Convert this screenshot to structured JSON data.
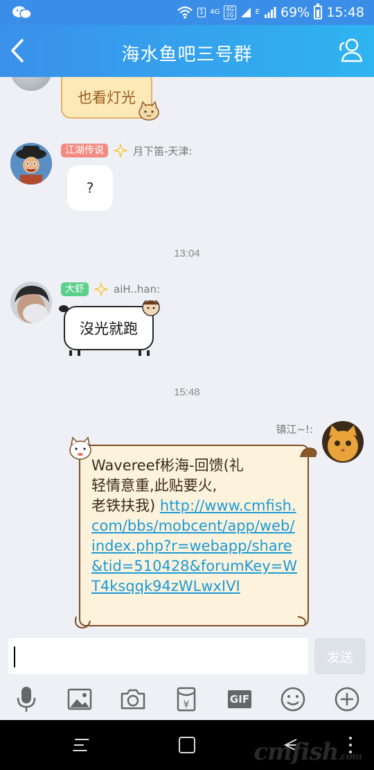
{
  "status_bar": {
    "network": "4G",
    "sim_label": "1",
    "dual_network": "4G\n2G",
    "e_label": "E",
    "battery": "69%",
    "time": "15:48"
  },
  "header": {
    "title": "海水鱼吧三号群"
  },
  "messages": [
    {
      "type": "text",
      "text": "也看灯光"
    },
    {
      "type": "text",
      "badge": "江湖传说",
      "sender": "月下笛-天津:",
      "text": "?"
    },
    {
      "type": "time",
      "text": "13:04"
    },
    {
      "type": "text",
      "badge": "大虾",
      "sender": "aiH..han:",
      "text": "沒光就跑"
    },
    {
      "type": "time",
      "text": "15:48"
    },
    {
      "type": "text",
      "sender": "镇江~!:",
      "text_plain": "Wavereef彬海-回馈(礼轻情意重,此贴要火,老铁扶我)",
      "text_line1": "Wavereef彬海-回馈(礼",
      "text_line2": "轻情意重,此贴要火,",
      "text_line3": "老铁扶我)",
      "link": "http://www.cmfish.com/bbs/mobcent/app/web/index.php?r=webapp/share&tid=510428&forumKey=WT4ksqqk94zWLwxIVI"
    }
  ],
  "input": {
    "value": "",
    "send_label": "发送"
  },
  "toolbar": {
    "items": [
      "mic-icon",
      "image-icon",
      "camera-icon",
      "red-packet-icon",
      "gif-icon",
      "emoji-icon",
      "plus-icon"
    ],
    "gif_label": "GIF",
    "red_packet_label": "¥"
  },
  "watermark": {
    "text": "cmfish",
    "suffix": ".com"
  },
  "colors": {
    "header_start": "#3a90ea",
    "header_end": "#2fb4f0",
    "chat_bg": "#eef0f5",
    "link": "#1a9ad6",
    "badge_red": "#f28b82",
    "badge_green": "#5bd08a"
  }
}
